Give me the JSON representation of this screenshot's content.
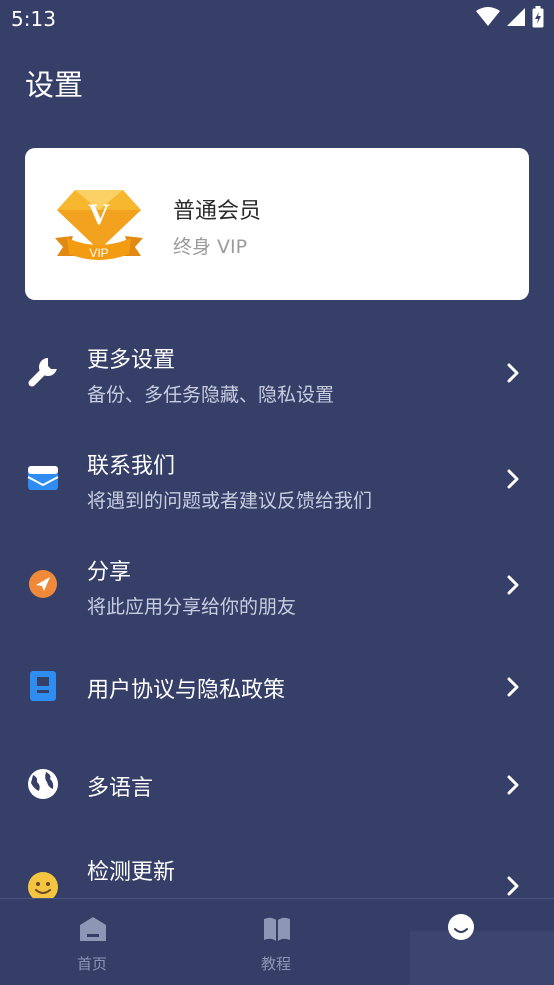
{
  "status": {
    "time": "5:13"
  },
  "title": "设置",
  "vip": {
    "title": "普通会员",
    "subtitle": "终身 VIP",
    "badge_letter": "V",
    "badge_text": "VIP"
  },
  "menu": [
    {
      "icon": "wrench-icon",
      "title": "更多设置",
      "subtitle": "备份、多任务隐藏、隐私设置"
    },
    {
      "icon": "mail-icon",
      "title": "联系我们",
      "subtitle": "将遇到的问题或者建议反馈给我们"
    },
    {
      "icon": "share-icon",
      "title": "分享",
      "subtitle": "将此应用分享给你的朋友"
    },
    {
      "icon": "document-icon",
      "title": "用户协议与隐私政策"
    },
    {
      "icon": "globe-icon",
      "title": "多语言"
    },
    {
      "icon": "smiley-icon",
      "title": "检测更新"
    }
  ],
  "nav": {
    "home": "首页",
    "tutorial": "教程"
  },
  "colors": {
    "background": "#353f68",
    "card": "#ffffff",
    "accent_orange": "#f5a623",
    "icon_blue": "#2f8cf0"
  }
}
